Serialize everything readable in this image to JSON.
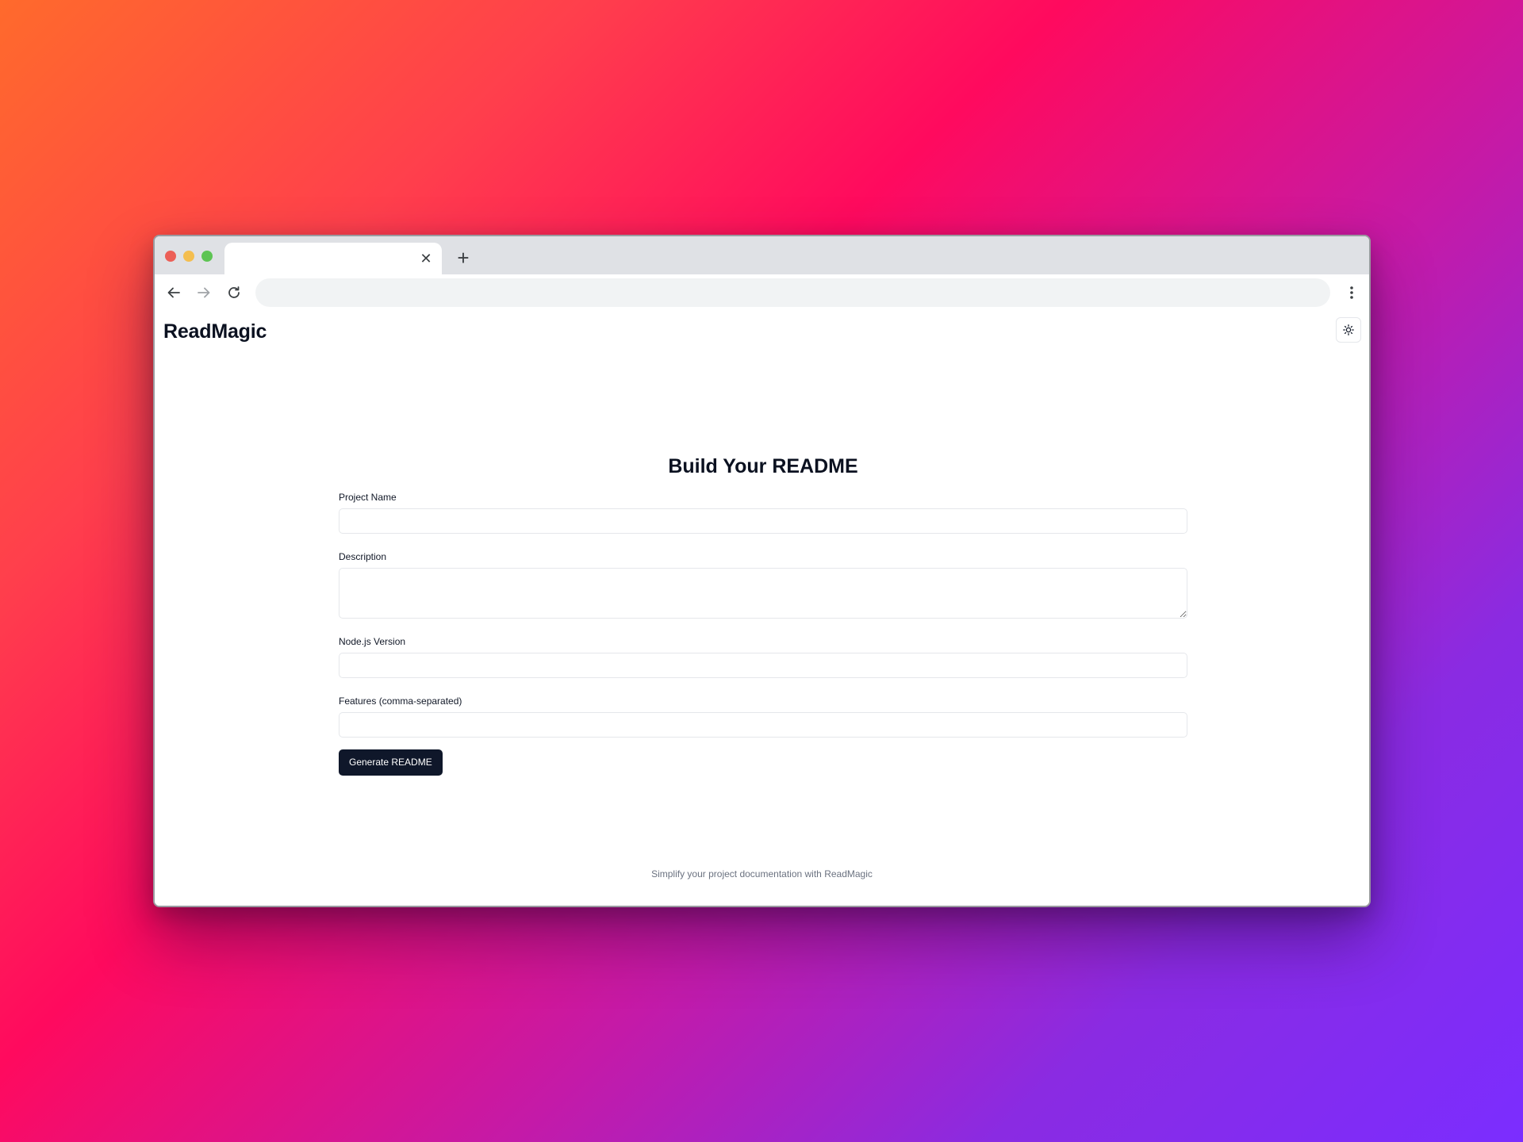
{
  "browser": {
    "tab_close_glyph": "✕",
    "new_tab_glyph": "+",
    "address_value": "",
    "icons": {
      "back": "arrow-left-icon",
      "forward": "arrow-right-icon",
      "reload": "reload-icon",
      "menu": "more-vertical-icon"
    },
    "traffic_colors": {
      "close": "#ec5f57",
      "minimize": "#f4be4f",
      "maximize": "#5dc453"
    }
  },
  "header": {
    "brand": "ReadMagic",
    "theme_toggle_icon": "sun-icon"
  },
  "form": {
    "title": "Build Your README",
    "fields": {
      "project_name": {
        "label": "Project Name",
        "value": "",
        "placeholder": ""
      },
      "description": {
        "label": "Description",
        "value": "",
        "placeholder": ""
      },
      "node_version": {
        "label": "Node.js Version",
        "value": "",
        "placeholder": ""
      },
      "features": {
        "label": "Features (comma-separated)",
        "value": "",
        "placeholder": ""
      }
    },
    "submit_label": "Generate README",
    "submit_color": "#0f172a"
  },
  "footer": {
    "text": "Simplify your project documentation with ReadMagic"
  }
}
